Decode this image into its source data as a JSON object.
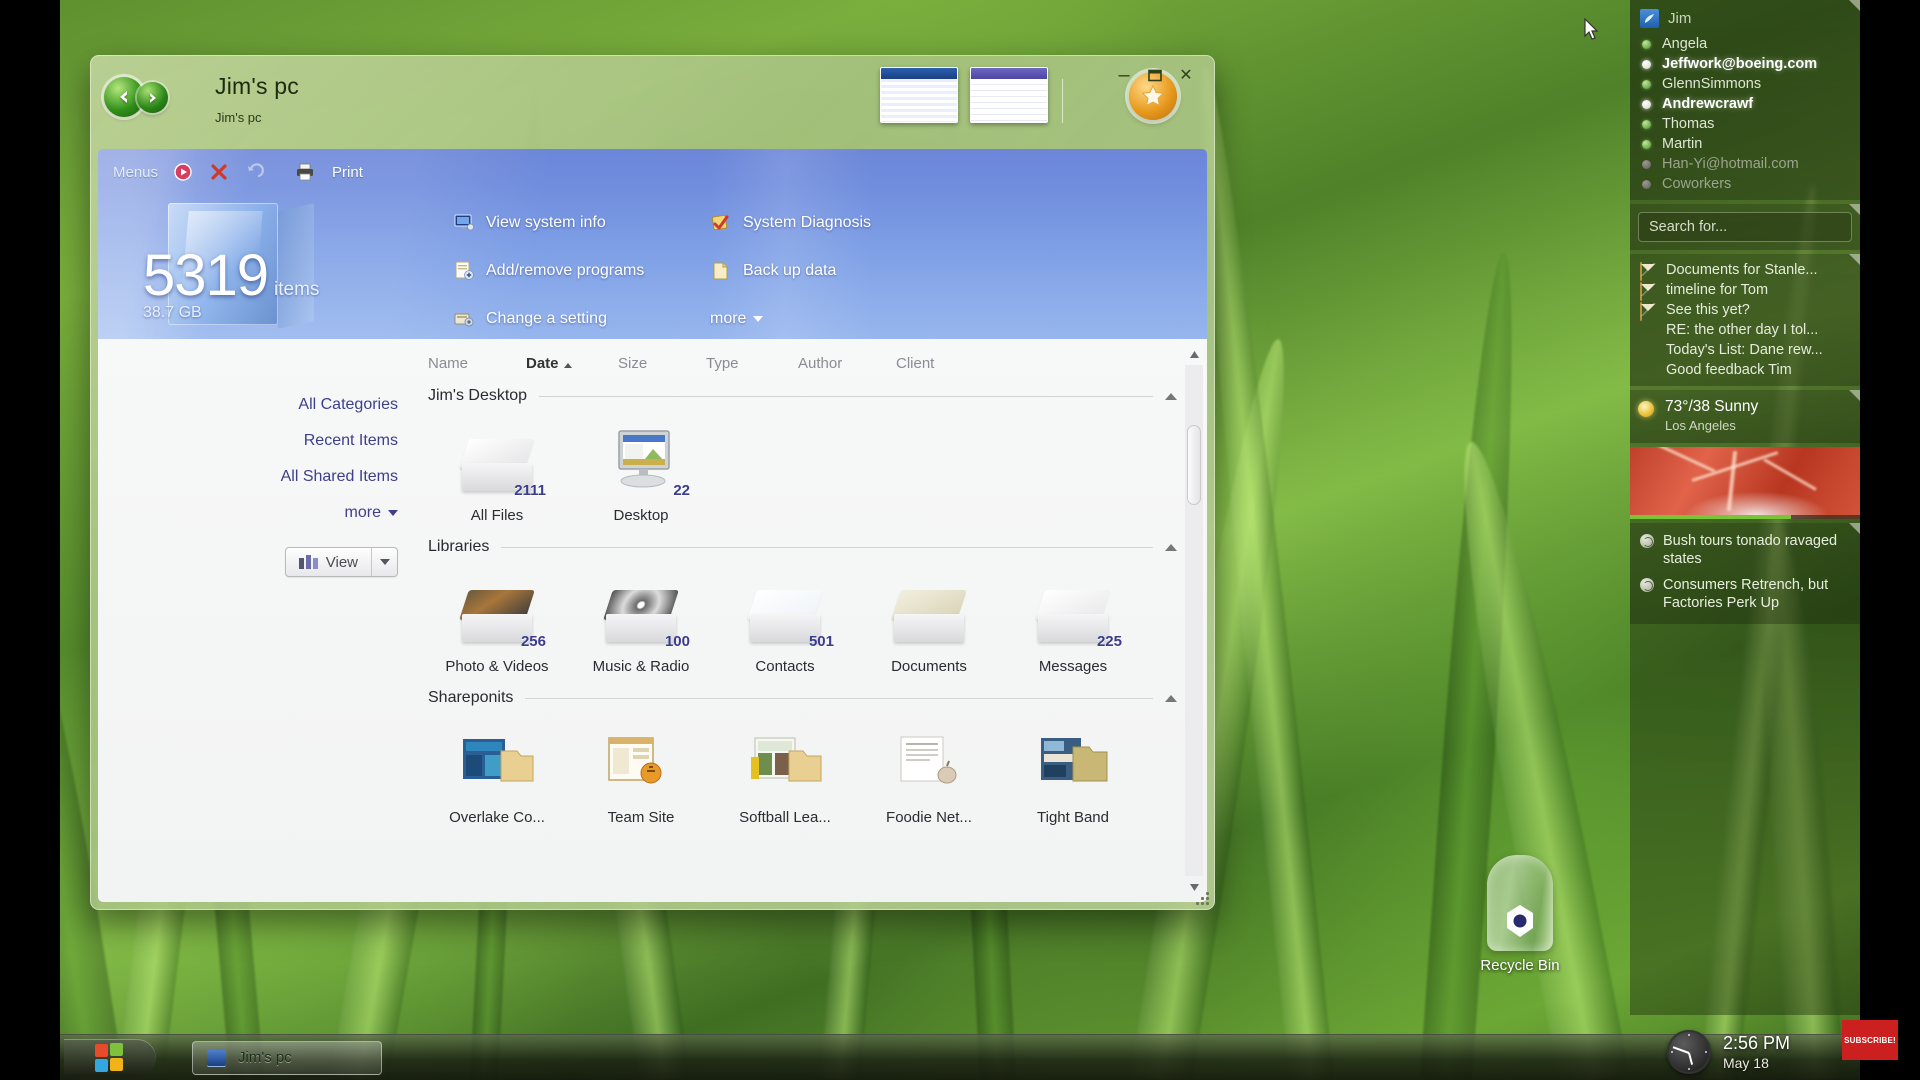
{
  "window": {
    "title": "Jim's pc",
    "subtitle": "Jim's pc",
    "nav": {
      "back": "back-arrow",
      "forward": "forward-arrow"
    },
    "controls": {
      "minimize": "–",
      "maximize": "□",
      "close": "✕"
    },
    "star_button": "favorites-star"
  },
  "menubar": {
    "menus_label": "Menus",
    "print_label": "Print",
    "icons": [
      "media-play-icon",
      "delete-x-icon",
      "undo-icon",
      "printer-icon"
    ]
  },
  "summary": {
    "count": "5319",
    "units": "items",
    "size": "38.7 GB"
  },
  "commands": {
    "column1": [
      {
        "label": "View system info",
        "icon": "monitor-icon"
      },
      {
        "label": "Add/remove programs",
        "icon": "programs-icon"
      },
      {
        "label": "Change a setting",
        "icon": "settings-icon"
      }
    ],
    "column2": [
      {
        "label": "System Diagnosis",
        "icon": "diagnosis-icon"
      },
      {
        "label": "Back up data",
        "icon": "backup-icon"
      }
    ],
    "more_label": "more"
  },
  "columns": [
    {
      "label": "Name",
      "sorted": false
    },
    {
      "label": "Date",
      "sorted": true
    },
    {
      "label": "Size",
      "sorted": false
    },
    {
      "label": "Type",
      "sorted": false
    },
    {
      "label": "Author",
      "sorted": false
    },
    {
      "label": "Client",
      "sorted": false
    }
  ],
  "rail": {
    "items": [
      "All Categories",
      "Recent Items",
      "All Shared Items"
    ],
    "more_label": "more",
    "view_label": "View"
  },
  "groups": [
    {
      "title": "Jim's Desktop",
      "tiles": [
        {
          "label": "All Files",
          "count": "2111",
          "icon": "files-stack-icon"
        },
        {
          "label": "Desktop",
          "count": "22",
          "icon": "monitor-desktop-icon"
        }
      ]
    },
    {
      "title": "Libraries",
      "tiles": [
        {
          "label": "Photo & Videos",
          "count": "256",
          "icon": "photos-stack-icon"
        },
        {
          "label": "Music & Radio",
          "count": "100",
          "icon": "cd-stack-icon"
        },
        {
          "label": "Contacts",
          "count": "501",
          "icon": "contacts-stack-icon"
        },
        {
          "label": "Documents",
          "count": "",
          "icon": "documents-stack-icon"
        },
        {
          "label": "Messages",
          "count": "225",
          "icon": "messages-stack-icon"
        }
      ]
    },
    {
      "title": "Shareponits",
      "tiles": [
        {
          "label": "Overlake Co...",
          "count": "",
          "icon": "sharepoint-folder-icon"
        },
        {
          "label": "Team Site",
          "count": "",
          "icon": "sharepoint-folder-icon"
        },
        {
          "label": "Softball Lea...",
          "count": "",
          "icon": "sharepoint-folder-icon"
        },
        {
          "label": "Foodie Net...",
          "count": "",
          "icon": "sharepoint-folder-icon"
        },
        {
          "label": "Tight Band",
          "count": "",
          "icon": "sharepoint-folder-icon"
        }
      ]
    }
  ],
  "sidebar": {
    "contacts": {
      "owner": "Jim",
      "list": [
        {
          "name": "Angela",
          "status": "online",
          "emphasis": "normal"
        },
        {
          "name": "Jeffwork@boeing.com",
          "status": "busy",
          "emphasis": "bold"
        },
        {
          "name": "GlennSimmons",
          "status": "online",
          "emphasis": "normal"
        },
        {
          "name": "Andrewcrawf",
          "status": "busy",
          "emphasis": "bold"
        },
        {
          "name": "Thomas",
          "status": "online",
          "emphasis": "normal"
        },
        {
          "name": "Martin",
          "status": "online",
          "emphasis": "normal"
        },
        {
          "name": "Han-Yi@hotmail.com",
          "status": "away",
          "emphasis": "dim"
        },
        {
          "name": "Coworkers",
          "status": "away",
          "emphasis": "dim"
        }
      ]
    },
    "search_placeholder": "Search for...",
    "messages": [
      {
        "label": "Documents for Stanle...",
        "icon": "envelope-icon"
      },
      {
        "label": "timeline for Tom",
        "icon": "envelope-icon"
      },
      {
        "label": "See this yet?",
        "icon": "envelope-icon"
      },
      {
        "label": "RE: the other day I tol...",
        "icon": "chat-bubble-icon"
      },
      {
        "label": "Today's List: Dane rew...",
        "icon": "chat-bubble-icon"
      },
      {
        "label": "Good feedback Tim",
        "icon": "chat-bubble-icon"
      }
    ],
    "weather": {
      "icon": "sun-icon",
      "temps": "73°/38 Sunny",
      "city": "Los Angeles"
    },
    "news": [
      {
        "label": "Bush tours tonado ravaged states",
        "icon": "rss-icon"
      },
      {
        "label": "Consumers Retrench, but Factories Perk Up",
        "icon": "rss-icon"
      }
    ]
  },
  "desktop": {
    "recycle_bin": "Recycle Bin"
  },
  "taskbar": {
    "start": "windows-start-orb",
    "task_label": "Jim's pc",
    "clock_time": "2:56  PM",
    "clock_date": "May 18",
    "subscribe_label": "SUBSCRIBE!"
  }
}
